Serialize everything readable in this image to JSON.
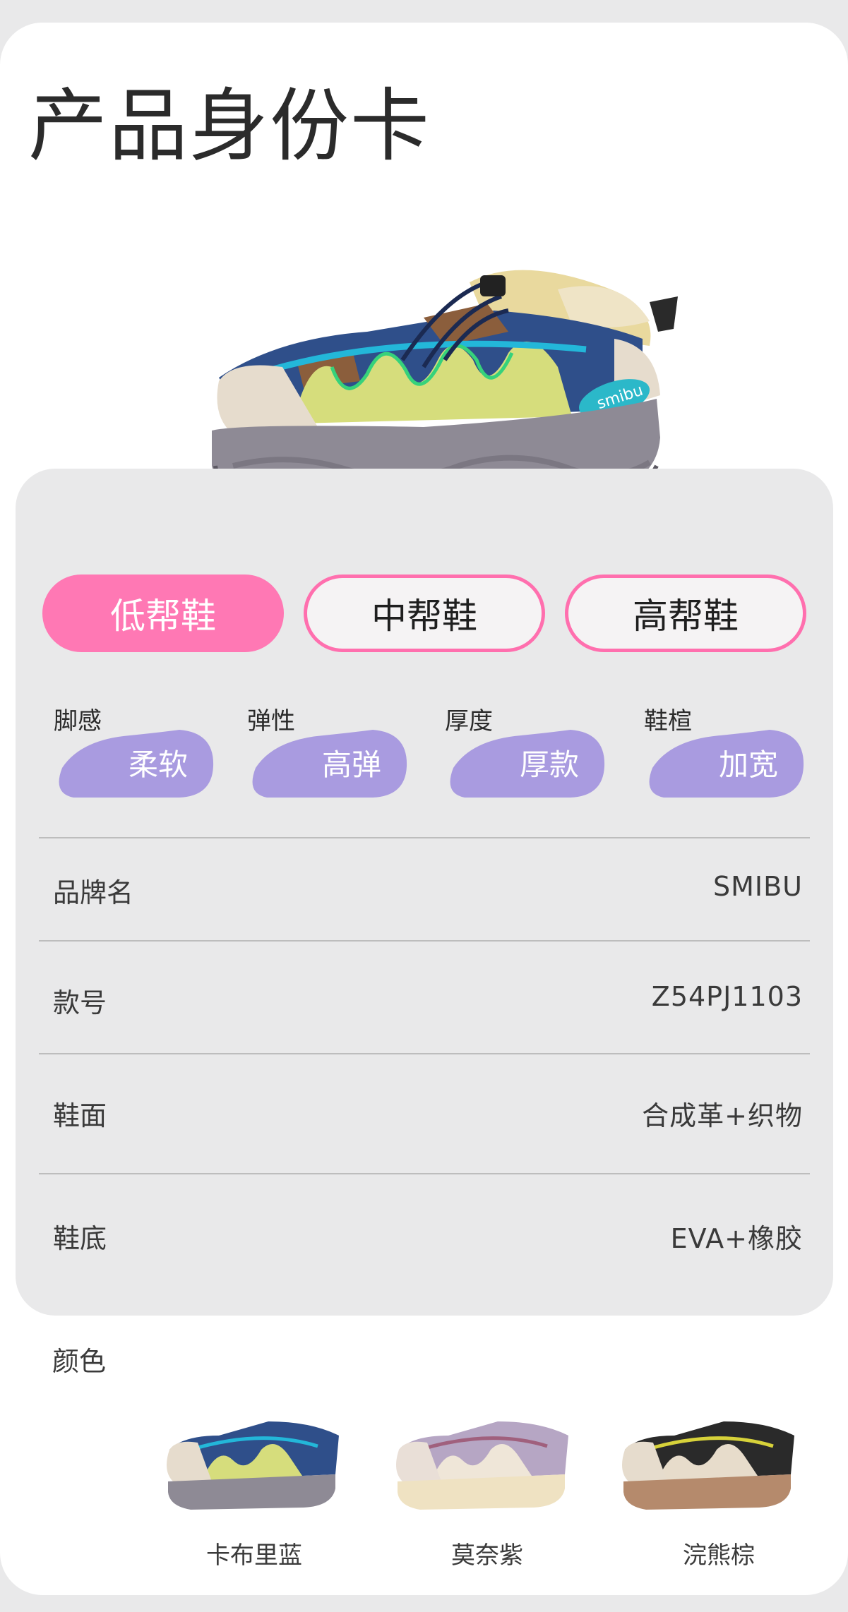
{
  "title": "产品身份卡",
  "type_tabs": [
    {
      "label": "低帮鞋",
      "active": true
    },
    {
      "label": "中帮鞋",
      "active": false
    },
    {
      "label": "高帮鞋",
      "active": false
    }
  ],
  "features": [
    {
      "label": "脚感",
      "value": "柔软"
    },
    {
      "label": "弹性",
      "value": "高弹"
    },
    {
      "label": "厚度",
      "value": "厚款"
    },
    {
      "label": "鞋楦",
      "value": "加宽"
    }
  ],
  "specs": [
    {
      "label": "品牌名",
      "value": "SMIBU"
    },
    {
      "label": "款号",
      "value": "Z54PJ1103"
    },
    {
      "label": "鞋面",
      "value": "合成革+织物"
    },
    {
      "label": "鞋底",
      "value": "EVA+橡胶"
    }
  ],
  "colors_title": "颜色",
  "colors": [
    {
      "name": "卡布里蓝"
    },
    {
      "name": "莫奈紫"
    },
    {
      "name": "浣熊棕"
    }
  ],
  "hero_logo": "smibu",
  "theme": {
    "accent_pink": "#ff78b4",
    "feature_purple": "#a99be0",
    "panel_gray": "#e9e9ea"
  }
}
